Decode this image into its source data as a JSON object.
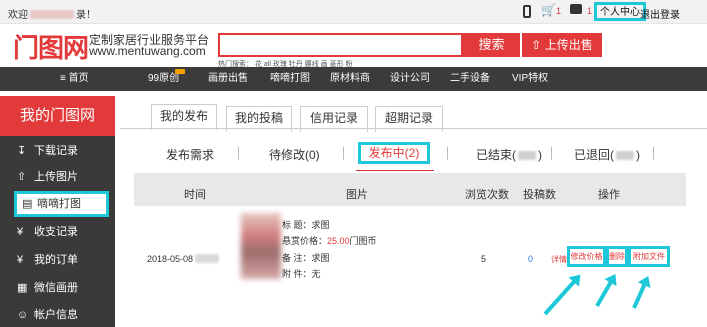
{
  "topbar": {
    "welcome_prefix": "欢迎",
    "welcome_suffix": "录！",
    "cart_count": "1",
    "message_count": "1",
    "personal_center": "个人中心",
    "logout": "退出登录"
  },
  "header": {
    "logo_text": "门图网",
    "tagline": "定制家居行业服务平台",
    "url": "www.mentuwang.com",
    "search_button": "搜索",
    "upload_button": "上传出售",
    "hot_search": "热门搜索： 花    all    玫瑰    牡丹    腰线    画    菱形    粉"
  },
  "nav": {
    "items": [
      "首页",
      "99原创",
      "画册出售",
      "嘀嘀打图",
      "原材料商",
      "设计公司",
      "二手设备",
      "VIP特权"
    ]
  },
  "sidebar": {
    "title": "我的门图网",
    "items": [
      "下载记录",
      "上传图片",
      "嘀嘀打图",
      "收支记录",
      "我的订单",
      "微信画册",
      "帐户信息"
    ]
  },
  "tabs": [
    "我的发布",
    "我的投稿",
    "信用记录",
    "超期记录"
  ],
  "subtabs": [
    "发布需求",
    "待修改(0)",
    "发布中(2)",
    "已结束(",
    ")",
    "已退回(",
    ")"
  ],
  "table": {
    "headers": [
      "时间",
      "图片",
      "浏览次数",
      "投稿数",
      "操作"
    ],
    "row": {
      "date": "2018-05-08",
      "title_label": "标      题：",
      "title_value": "求图",
      "reward_label": "悬赏价格：",
      "reward_value": "25.00",
      "reward_unit": "门图币",
      "note_label": "备      注：",
      "note_value": "求图",
      "attach_label": "附      件：",
      "attach_value": "无",
      "views": "5",
      "bids": "0",
      "op_detail": "详情",
      "op_edit_price": "修改价格",
      "op_delete": "删除",
      "op_attach": "附加文件"
    }
  }
}
